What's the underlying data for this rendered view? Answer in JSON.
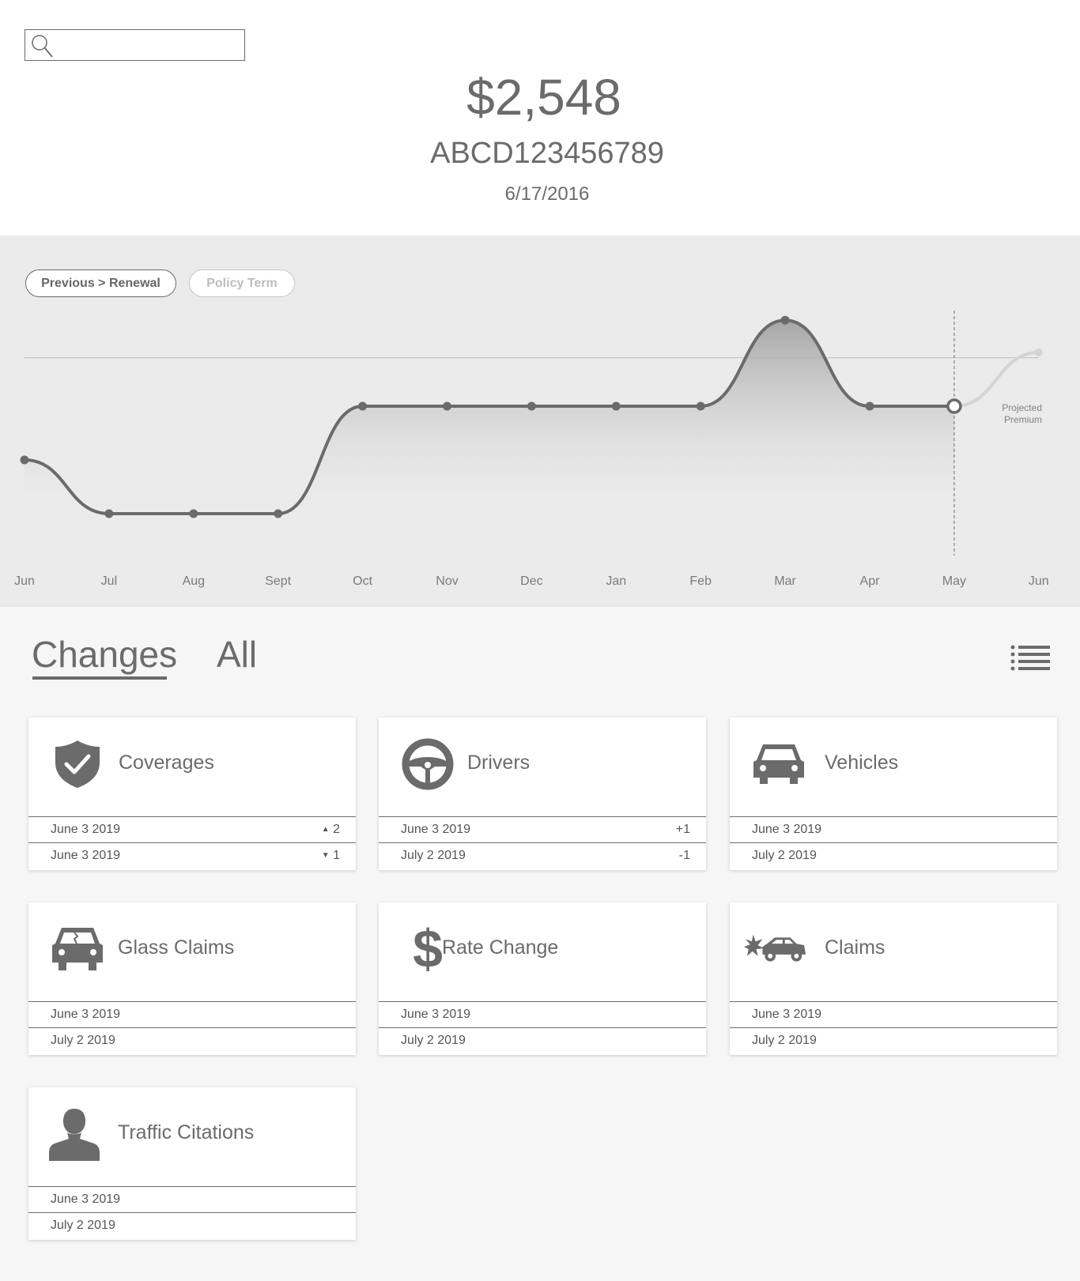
{
  "header": {
    "search": {
      "value": "",
      "placeholder": ""
    },
    "amount": "$2,548",
    "policy_number": "ABCD123456789",
    "date": "6/17/2016"
  },
  "chart_toggle": {
    "active_label": "Previous > Renewal",
    "inactive_label": "Policy Term"
  },
  "chart_data": {
    "type": "area",
    "categories": [
      "Jun",
      "Jul",
      "Aug",
      "Sept",
      "Oct",
      "Nov",
      "Dec",
      "Jan",
      "Feb",
      "Mar",
      "Apr",
      "May",
      "Jun"
    ],
    "series": [
      {
        "values": [
          2,
          1,
          1,
          1,
          3,
          3,
          3,
          3,
          3,
          4.6,
          3,
          3,
          null
        ]
      },
      {
        "name": "Projected Premium",
        "values": [
          null,
          null,
          null,
          null,
          null,
          null,
          null,
          null,
          null,
          null,
          null,
          3,
          4
        ]
      }
    ],
    "reference_line": 3.9,
    "ylim": [
      0,
      5
    ],
    "annotation": "Projected\nPremium",
    "annotation_lines": [
      "Projected",
      "Premium"
    ],
    "grid": false
  },
  "tabs": [
    {
      "label": "Changes",
      "active": true
    },
    {
      "label": "All",
      "active": false
    }
  ],
  "cards": [
    {
      "title": "Coverages",
      "icon": "shield-check-icon",
      "rows": [
        {
          "date": "June 3 2019",
          "value": "2",
          "trend": "up"
        },
        {
          "date": "June 3 2019",
          "value": "1",
          "trend": "down"
        }
      ]
    },
    {
      "title": "Drivers",
      "icon": "steering-wheel-icon",
      "rows": [
        {
          "date": "June 3 2019",
          "value": "+1"
        },
        {
          "date": "July 2 2019",
          "value": "-1"
        }
      ]
    },
    {
      "title": "Vehicles",
      "icon": "car-icon",
      "rows": [
        {
          "date": "June 3 2019",
          "value": ""
        },
        {
          "date": "July 2 2019",
          "value": ""
        }
      ]
    },
    {
      "title": "Glass Claims",
      "icon": "cracked-windshield-car-icon",
      "rows": [
        {
          "date": "June 3 2019",
          "value": ""
        },
        {
          "date": "July 2 2019",
          "value": ""
        }
      ]
    },
    {
      "title": "Rate Change",
      "icon": "dollar-icon",
      "rows": [
        {
          "date": "June 3 2019",
          "value": ""
        },
        {
          "date": "July 2 2019",
          "value": ""
        }
      ]
    },
    {
      "title": "Claims",
      "icon": "car-crash-icon",
      "rows": [
        {
          "date": "June 3 2019",
          "value": ""
        },
        {
          "date": "July 2 2019",
          "value": ""
        }
      ]
    },
    {
      "title": "Traffic Citations",
      "icon": "person-icon",
      "rows": [
        {
          "date": "June 3 2019",
          "value": ""
        },
        {
          "date": "July 2 2019",
          "value": ""
        }
      ]
    }
  ],
  "colors": {
    "ink": "#6b6b6b",
    "chart_bg": "#ebebeb",
    "page_bg": "#f6f6f6",
    "projected": "#d4d4d4"
  }
}
